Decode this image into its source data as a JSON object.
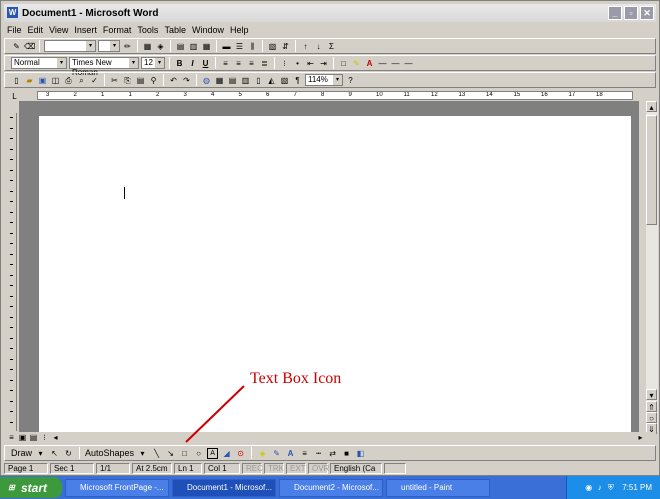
{
  "window": {
    "title": "Document1 - Microsoft Word"
  },
  "menu": [
    "File",
    "Edit",
    "View",
    "Insert",
    "Format",
    "Tools",
    "Table",
    "Window",
    "Help"
  ],
  "formatting": {
    "style": "Normal",
    "font": "Times New Roman",
    "size": "12",
    "zoom": "114%"
  },
  "ruler": {
    "marks": [
      "3",
      "2",
      "1",
      "1",
      "2",
      "3",
      "4",
      "5",
      "6",
      "7",
      "8",
      "9",
      "10",
      "11",
      "12",
      "13",
      "14",
      "15",
      "16",
      "17",
      "18"
    ]
  },
  "drawbar": {
    "draw_label": "Draw",
    "autoshapes_label": "AutoShapes"
  },
  "status": {
    "page": "Page 1",
    "sec": "Sec 1",
    "pages": "1/1",
    "at": "At 2.5cm",
    "ln": "Ln 1",
    "col": "Col 1",
    "rec": "REC",
    "trk": "TRK",
    "ext": "EXT",
    "ovr": "OVR",
    "lang": "English (Ca"
  },
  "annotation": {
    "text": "Text Box Icon",
    "color": "#cc0000"
  },
  "taskbar": {
    "start": "start",
    "tasks": [
      "Microsoft FrontPage -...",
      "Document1 - Microsof...",
      "Document2 - Microsof...",
      "untitled - Paint"
    ],
    "time": "7:51 PM"
  },
  "colors": {
    "taskbar": "#3a6fd8",
    "start": "#3c9a3c",
    "tray": "#1c8ee8"
  }
}
